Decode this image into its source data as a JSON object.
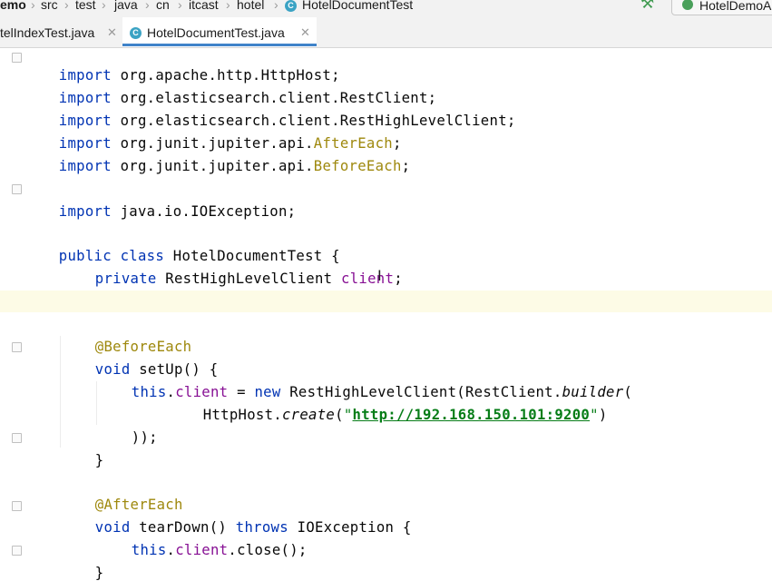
{
  "breadcrumb": {
    "items": [
      "emo",
      "src",
      "test",
      "java",
      "cn",
      "itcast",
      "hotel",
      "HotelDocumentTest"
    ],
    "run_config": "HotelDemoA"
  },
  "tabs": [
    {
      "label": "telIndexTest.java",
      "active": false
    },
    {
      "label": "HotelDocumentTest.java",
      "active": true
    }
  ],
  "editor": {
    "lines": [
      {
        "kind": "import",
        "kw": "import",
        "text": " org.apache.http.HttpHost;"
      },
      {
        "kind": "import",
        "kw": "import",
        "text": " org.elasticsearch.client.RestClient;"
      },
      {
        "kind": "import",
        "kw": "import",
        "text": " org.elasticsearch.client.RestHighLevelClient;"
      },
      {
        "kind": "import",
        "kw": "import",
        "pre": " org.junit.jupiter.api.",
        "ann": "AfterEach",
        "post": ";"
      },
      {
        "kind": "import",
        "kw": "import",
        "pre": " org.junit.jupiter.api.",
        "ann": "BeforeEach",
        "post": ";"
      },
      {
        "kind": "import",
        "kw": "import",
        "text": " java.io.IOException;"
      },
      {
        "kind": "class",
        "kw1": "public",
        "kw2": "class",
        "name": " HotelDocumentTest {"
      },
      {
        "kind": "field",
        "kw": "private",
        "type": " RestHighLevelClient ",
        "field": "client",
        "end": ";"
      },
      {
        "kind": "annotation",
        "text": "@BeforeEach"
      },
      {
        "kind": "method",
        "kw": "void",
        "text": " setUp() {"
      },
      {
        "kind": "assign",
        "kw1": "this",
        "dot": ".",
        "field": "client",
        "mid": " = ",
        "kw2": "new",
        "rest1": " RestHighLevelClient(RestClient.",
        "italic": "builder",
        "rest2": "("
      },
      {
        "kind": "call",
        "pre": "HttpHost.",
        "italic": "create",
        "open": "(",
        "q1": "\"",
        "url": "http://192.168.150.101:9200",
        "q2": "\"",
        "close": ")"
      },
      {
        "kind": "plain",
        "text": "));"
      },
      {
        "kind": "plain",
        "text": "}"
      },
      {
        "kind": "annotation",
        "text": "@AfterEach"
      },
      {
        "kind": "method",
        "kw": "void",
        "text": " tearDown() ",
        "kw2": "throws",
        "text2": " IOException {"
      },
      {
        "kind": "close",
        "kw": "this",
        "dot": ".",
        "field": "client",
        "rest": ".close();"
      },
      {
        "kind": "plain",
        "text": "}"
      },
      {
        "kind": "plain",
        "text": "}"
      }
    ]
  },
  "colors": {
    "keyword": "#0033b3",
    "annotation": "#9e880d",
    "string": "#067d17",
    "field": "#871094",
    "tab_accent": "#4083c9",
    "current_line": "#fdfbe6"
  }
}
